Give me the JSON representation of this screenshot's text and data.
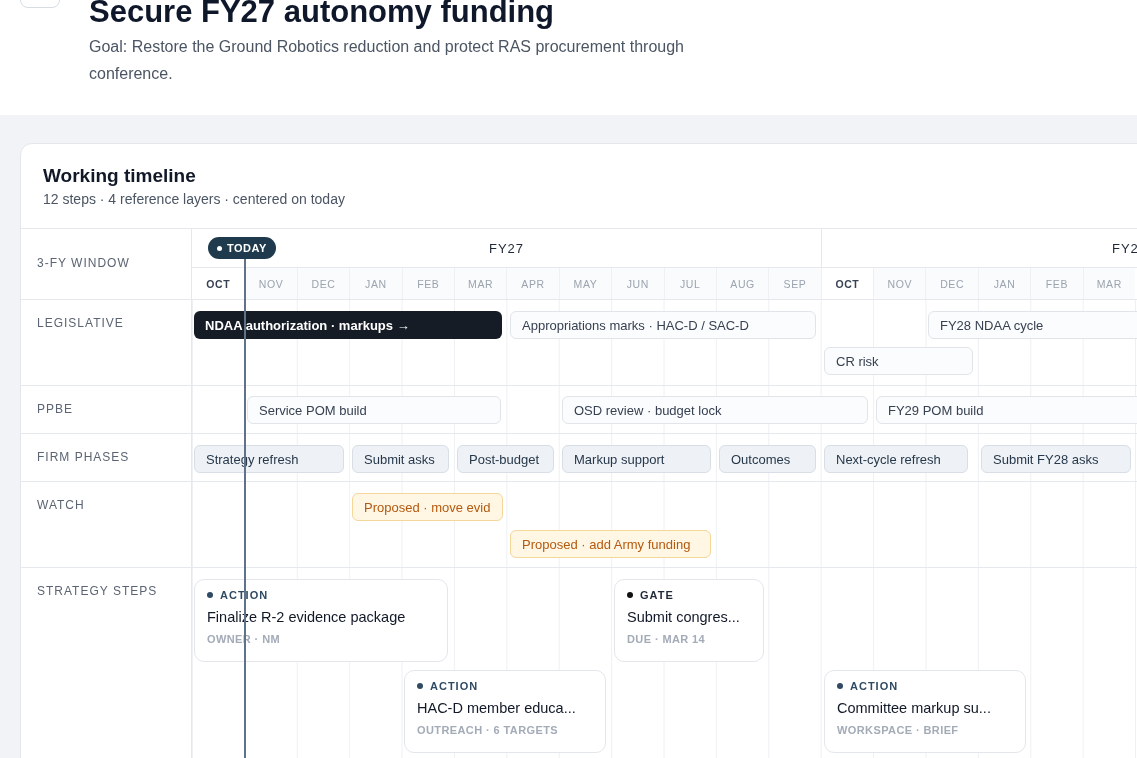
{
  "header": {
    "title": "Secure FY27 autonomy funding",
    "goal": "Goal: Restore the Ground Robotics reduction and protect RAS procurement through conference."
  },
  "timeline": {
    "title": "Working timeline",
    "subtitle": "12 steps · 4 reference layers · centered on today",
    "window_label": "3-FY WINDOW",
    "today_label": "TODAY",
    "fiscal_years": [
      {
        "label": "FY27"
      },
      {
        "label": "FY2"
      }
    ],
    "months": [
      {
        "label": "OCT",
        "strong": true
      },
      {
        "label": "NOV",
        "strong": false
      },
      {
        "label": "DEC",
        "strong": false
      },
      {
        "label": "JAN",
        "strong": false
      },
      {
        "label": "FEB",
        "strong": false
      },
      {
        "label": "MAR",
        "strong": false
      },
      {
        "label": "APR",
        "strong": false
      },
      {
        "label": "MAY",
        "strong": false
      },
      {
        "label": "JUN",
        "strong": false
      },
      {
        "label": "JUL",
        "strong": false
      },
      {
        "label": "AUG",
        "strong": false
      },
      {
        "label": "SEP",
        "strong": false
      },
      {
        "label": "OCT",
        "strong": true
      },
      {
        "label": "NOV",
        "strong": false
      },
      {
        "label": "DEC",
        "strong": false
      },
      {
        "label": "JAN",
        "strong": false
      },
      {
        "label": "FEB",
        "strong": false
      },
      {
        "label": "MAR",
        "strong": false
      }
    ],
    "lanes": [
      {
        "label": "LEGISLATIVE",
        "bars": [
          {
            "text": "NDAA authorization · markups →",
            "kind": "current"
          },
          {
            "text": "Appropriations marks · HAC-D / SAC-D",
            "kind": "reference"
          },
          {
            "text": "FY28 NDAA cycle",
            "kind": "reference"
          },
          {
            "text": "CR risk",
            "kind": "reference"
          }
        ]
      },
      {
        "label": "PPBE",
        "bars": [
          {
            "text": "Service POM build",
            "kind": "reference"
          },
          {
            "text": "OSD review · budget lock",
            "kind": "reference"
          },
          {
            "text": "FY29 POM build",
            "kind": "reference"
          }
        ]
      },
      {
        "label": "FIRM PHASES",
        "bars": [
          {
            "text": "Strategy refresh",
            "kind": "phase"
          },
          {
            "text": "Submit asks",
            "kind": "phase"
          },
          {
            "text": "Post-budget",
            "kind": "phase"
          },
          {
            "text": "Markup support",
            "kind": "phase"
          },
          {
            "text": "Outcomes",
            "kind": "phase"
          },
          {
            "text": "Next-cycle refresh",
            "kind": "phase"
          },
          {
            "text": "Submit FY28 asks",
            "kind": "phase"
          }
        ]
      },
      {
        "label": "WATCH",
        "bars": [
          {
            "text": "Proposed · move evid",
            "kind": "proposed"
          },
          {
            "text": "Proposed · add Army funding",
            "kind": "proposed"
          }
        ]
      }
    ],
    "steps_label": "STRATEGY STEPS",
    "steps": [
      {
        "kind": "action",
        "tag": "ACTION",
        "title": "Finalize R-2 evidence package",
        "meta": "OWNER · NM"
      },
      {
        "kind": "gate",
        "tag": "GATE",
        "title": "Submit congres...",
        "meta": "DUE · MAR 14"
      },
      {
        "kind": "action",
        "tag": "ACTION",
        "title": "HAC-D member educa...",
        "meta": "OUTREACH · 6 TARGETS"
      },
      {
        "kind": "action",
        "tag": "ACTION",
        "title": "Committee markup su...",
        "meta": "WORKSPACE · BRIEF"
      }
    ]
  }
}
